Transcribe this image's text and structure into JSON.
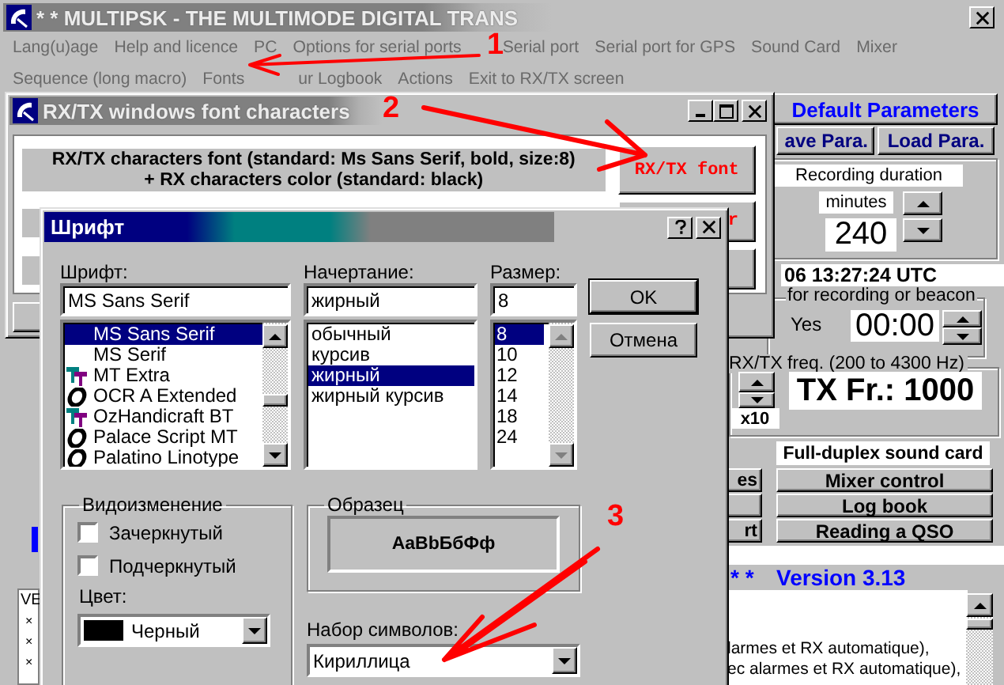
{
  "main_window": {
    "title": "* * MULTIPSK - THE MULTIMODE DIGITAL TRANS",
    "menu_rows": [
      [
        "Lang(u)age",
        "Help and licence",
        "PC",
        "Options for serial ports",
        "Serial port",
        "Serial port for GPS",
        "Sound Card",
        "Mixer"
      ],
      [
        "Sequence (long macro)",
        "Fonts",
        "ur Logbook",
        "Actions",
        "Exit to RX/TX screen"
      ]
    ],
    "default_button": "Default Parameters",
    "save_button": "ave Para.",
    "load_button": "Load Para.",
    "recording": {
      "label": "Recording duration",
      "unit": "minutes",
      "value": "240"
    },
    "clock": "06 13:27:24 UTC",
    "beacon": {
      "label": "for recording or beacon",
      "option": "Yes",
      "time": "00:00"
    },
    "frequency": {
      "label": "RX/TX freq. (200 to 4300 Hz)",
      "multiplier": "x10",
      "tx": "TX Fr.: 1000"
    },
    "sound_card": "Full-duplex sound card",
    "side_rows": [
      {
        "stub": "es",
        "label": "Mixer control"
      },
      {
        "label": "Log book"
      },
      {
        "stub": "rt",
        "label": "Reading a QSO"
      }
    ],
    "version": {
      "prefix": "* *",
      "label": "Version 3.13"
    },
    "log_lines": [
      "larmes et RX automatique),",
      "ec alarmes et RX automatique),"
    ],
    "left_fragment": {
      "label": "VE",
      "marks": [
        "×",
        "×",
        "×"
      ]
    }
  },
  "font_window": {
    "title": "RX/TX windows font characters",
    "description": [
      "RX/TX characters font (standard: Ms Sans Serif, bold, size:8)",
      "+ RX characters color (standard: black)"
    ],
    "font_button": "RX/TX font",
    "color_button": "r"
  },
  "font_dialog": {
    "title": "Шрифт",
    "font": {
      "label": "Шрифт:",
      "value": "MS Sans Serif",
      "items": [
        {
          "name": "MS Sans Serif",
          "kind": "bitmap",
          "selected": true
        },
        {
          "name": "MS Serif",
          "kind": "bitmap",
          "selected": false
        },
        {
          "name": "MT Extra",
          "kind": "truetype",
          "selected": false
        },
        {
          "name": "OCR A Extended",
          "kind": "opentype",
          "selected": false
        },
        {
          "name": "OzHandicraft BT",
          "kind": "truetype",
          "selected": false
        },
        {
          "name": "Palace Script MT",
          "kind": "opentype",
          "selected": false
        },
        {
          "name": "Palatino Linotype",
          "kind": "opentype",
          "selected": false
        }
      ]
    },
    "style": {
      "label": "Начертание:",
      "value": "жирный",
      "items": [
        {
          "name": "обычный",
          "selected": false
        },
        {
          "name": "курсив",
          "selected": false
        },
        {
          "name": "жирный",
          "selected": true
        },
        {
          "name": "жирный курсив",
          "selected": false
        }
      ]
    },
    "size": {
      "label": "Размер:",
      "value": "8",
      "items": [
        {
          "name": "8",
          "selected": true
        },
        {
          "name": "10",
          "selected": false
        },
        {
          "name": "12",
          "selected": false
        },
        {
          "name": "14",
          "selected": false
        },
        {
          "name": "18",
          "selected": false
        },
        {
          "name": "24",
          "selected": false
        }
      ]
    },
    "buttons": [
      "OK",
      "Отмена"
    ],
    "effects": {
      "title": "Видоизменение",
      "checkboxes": [
        {
          "label": "Зачеркнутый",
          "checked": false
        },
        {
          "label": "Подчеркнутый",
          "checked": false
        }
      ],
      "color_label": "Цвет:",
      "color": {
        "name": "Черный",
        "color": "#000000"
      }
    },
    "sample": {
      "title": "Образец",
      "text": "AaBbБбФф"
    },
    "charset": {
      "label": "Набор символов:",
      "value": "Кириллица"
    }
  },
  "annotations": [
    {
      "label": "1"
    },
    {
      "label": "2"
    },
    {
      "label": "3"
    }
  ]
}
